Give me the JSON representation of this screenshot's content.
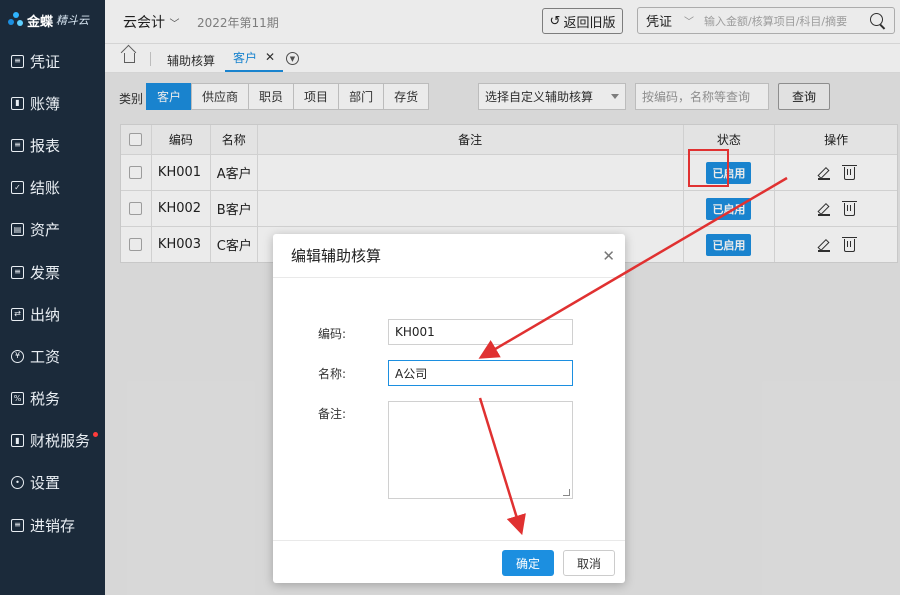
{
  "logo": {
    "brand": "金蝶",
    "product": "精斗云"
  },
  "sidebar": {
    "items": [
      {
        "label": "凭证",
        "icon": "document-icon"
      },
      {
        "label": "账簿",
        "icon": "ledger-icon"
      },
      {
        "label": "报表",
        "icon": "report-icon"
      },
      {
        "label": "结账",
        "icon": "checkout-icon"
      },
      {
        "label": "资产",
        "icon": "asset-icon"
      },
      {
        "label": "发票",
        "icon": "invoice-icon"
      },
      {
        "label": "出纳",
        "icon": "cashier-icon"
      },
      {
        "label": "工资",
        "icon": "yen-icon"
      },
      {
        "label": "税务",
        "icon": "tax-icon"
      },
      {
        "label": "财税服务",
        "icon": "service-icon",
        "badge_dot": true
      },
      {
        "label": "设置",
        "icon": "gear-icon"
      },
      {
        "label": "进销存",
        "icon": "inventory-icon"
      }
    ]
  },
  "header": {
    "account": "云会计",
    "period": "2022年第11期",
    "back_button": "返回旧版",
    "search_type": "凭证",
    "search_placeholder": "输入金额/核算项目/科目/摘要"
  },
  "tabs": {
    "first": "辅助核算",
    "active": "客户"
  },
  "filter": {
    "label": "类别",
    "categories": [
      "客户",
      "供应商",
      "职员",
      "项目",
      "部门",
      "存货"
    ],
    "active_category": "客户",
    "custom_select": "选择自定义辅助核算",
    "code_placeholder": "按编码，名称等查询",
    "query_button": "查询"
  },
  "table": {
    "headers": {
      "code": "编码",
      "name": "名称",
      "note": "备注",
      "status": "状态",
      "ops": "操作"
    },
    "rows": [
      {
        "code": "KH001",
        "name": "A客户",
        "note": "",
        "status": "已启用"
      },
      {
        "code": "KH002",
        "name": "B客户",
        "note": "",
        "status": "已启用"
      },
      {
        "code": "KH003",
        "name": "C客户",
        "note": "",
        "status": "已启用"
      }
    ]
  },
  "modal": {
    "title": "编辑辅助核算",
    "code_label": "编码:",
    "code_value": "KH001",
    "name_label": "名称:",
    "name_value": "A公司",
    "note_label": "备注:",
    "note_value": "",
    "ok_button": "确定",
    "cancel_button": "取消"
  },
  "colors": {
    "sidebar_bg": "#1b2a3a",
    "accent": "#1c8fe0",
    "annotation": "#e03131"
  }
}
